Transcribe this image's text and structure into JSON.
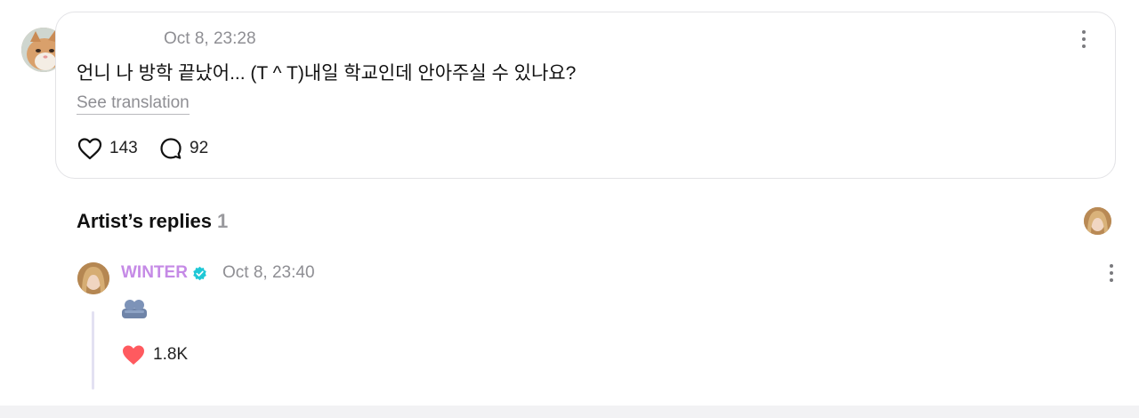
{
  "post": {
    "timestamp": "Oct 8, 23:28",
    "text": "언니 나 방학 끝났어... (T ^ T)내일 학교인데 안아주실 수 있나요?",
    "translation_label": "See translation",
    "likes": "143",
    "comments": "92",
    "avatar_icon": "cat-avatar",
    "menu_icon": "more-vertical-icon"
  },
  "artist_replies": {
    "title": "Artist’s replies",
    "count": "1",
    "reply": {
      "author": "WINTER",
      "author_color": "#c58ae6",
      "verified_color": "#1fc8d6",
      "timestamp": "Oct 8, 23:40",
      "sticker_icon": "sticker-icon",
      "likes": "1.8K",
      "like_color": "#ff5a5f"
    }
  },
  "colors": {
    "muted_text": "#8e8e93",
    "card_border": "#e3e3e6",
    "thread_line": "#e3e1f2"
  }
}
